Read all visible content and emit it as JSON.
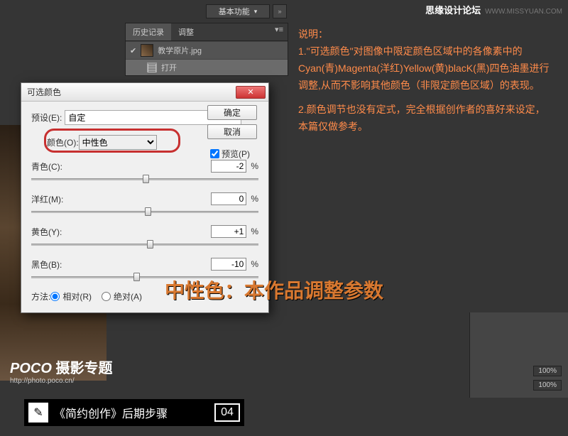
{
  "watermark": {
    "cn": "思缘设计论坛",
    "en": "WWW.MISSYUAN.COM"
  },
  "workspace": {
    "label": "基本功能",
    "arrows": "»"
  },
  "history": {
    "tabs": [
      "历史记录",
      "调整"
    ],
    "items": [
      {
        "label": "教学原片.jpg"
      },
      {
        "label": "打开"
      }
    ]
  },
  "dialog": {
    "title": "可选颜色",
    "close": "✕",
    "preset_label": "预设(E):",
    "preset_value": "自定",
    "color_label": "颜色(O):",
    "color_value": "中性色",
    "sliders": [
      {
        "label": "青色(C):",
        "value": "-2",
        "pct": "%",
        "pos": 49
      },
      {
        "label": "洋红(M):",
        "value": "0",
        "pct": "%",
        "pos": 50
      },
      {
        "label": "黄色(Y):",
        "value": "+1",
        "pct": "%",
        "pos": 51
      },
      {
        "label": "黑色(B):",
        "value": "-10",
        "pct": "%",
        "pos": 45
      }
    ],
    "method_label": "方法:",
    "method_rel": "相对(R)",
    "method_abs": "绝对(A)",
    "ok": "确定",
    "cancel": "取消",
    "preview": "预览(P)"
  },
  "explain": {
    "heading": "说明：",
    "p1": "1.\"可选颜色\"对图像中限定颜色区域中的各像素中的Cyan(青)Magenta(洋红)Yellow(黄)blacK(黑)四色油墨进行调整,从而不影响其他颜色（非限定颜色区域）的表现。",
    "p2": "2.颜色调节也没有定式，完全根据创作者的喜好来设定，本篇仅做参考。"
  },
  "big_label": "中性色：本作品调整参数",
  "poco": {
    "line1a": "POCO",
    "line1b": " 摄影专题",
    "line2": "http://photo.poco.cn/"
  },
  "bottom": {
    "icon": "✎",
    "text": "《简约创作》后期步骤",
    "num": "04"
  },
  "side": {
    "op": "100%"
  }
}
